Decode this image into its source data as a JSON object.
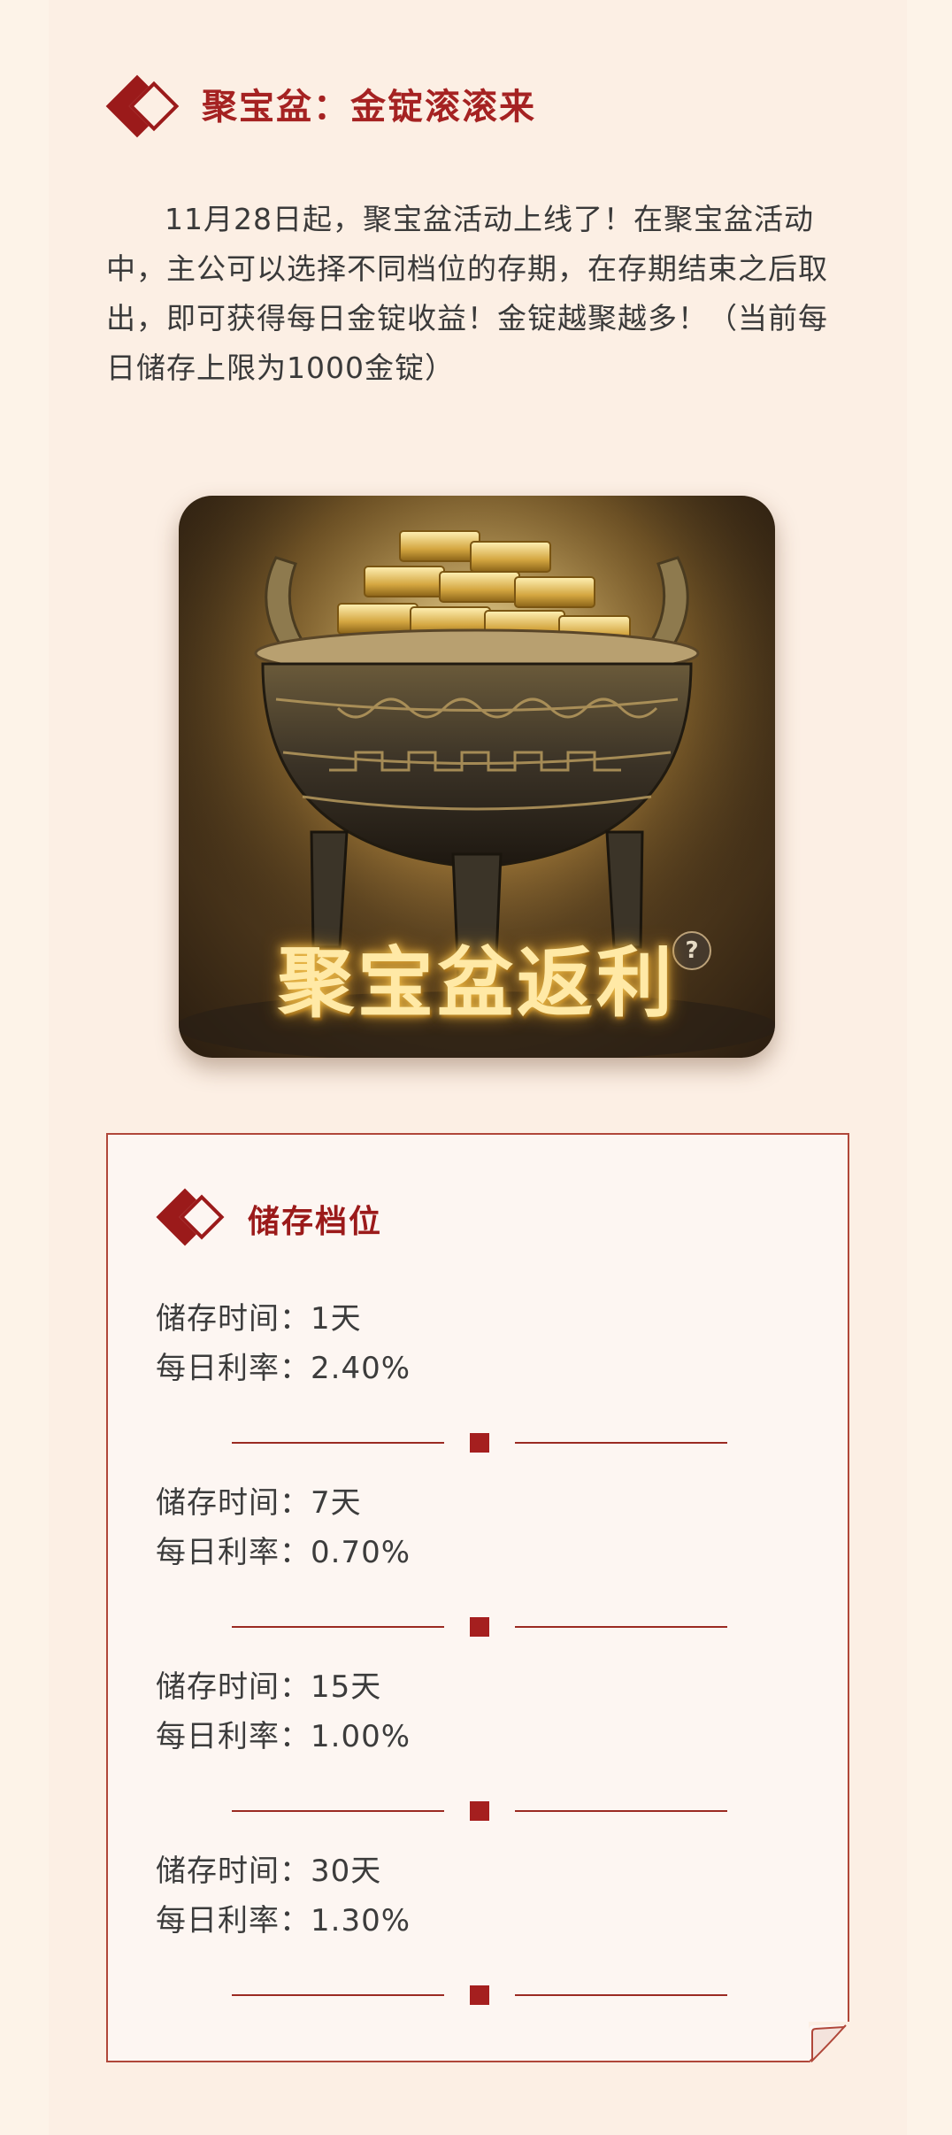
{
  "section": {
    "title": "聚宝盆：金锭滚滚来",
    "icon": "double-diamond-icon",
    "intro": "11月28日起，聚宝盆活动上线了！在聚宝盆活动中，主公可以选择不同档位的存期，在存期结束之后取出，即可获得每日金锭收益！金锭越聚越多！（当前每日储存上限为1000金锭）"
  },
  "banner": {
    "caption": "聚宝盆返利",
    "help": "?"
  },
  "card": {
    "title": "储存档位",
    "icon": "double-diamond-icon",
    "tiers": [
      {
        "duration": "储存时间：1天",
        "rate": "每日利率：2.40%"
      },
      {
        "duration": "储存时间：7天",
        "rate": "每日利率：0.70%"
      },
      {
        "duration": "储存时间：15天",
        "rate": "每日利率：1.00%"
      },
      {
        "duration": "储存时间：30天",
        "rate": "每日利率：1.30%"
      }
    ]
  },
  "colors": {
    "accent": "#9b1a1a",
    "background": "#fcefe4",
    "card_bg": "#fdf6f2",
    "text": "#3c3c3c"
  }
}
